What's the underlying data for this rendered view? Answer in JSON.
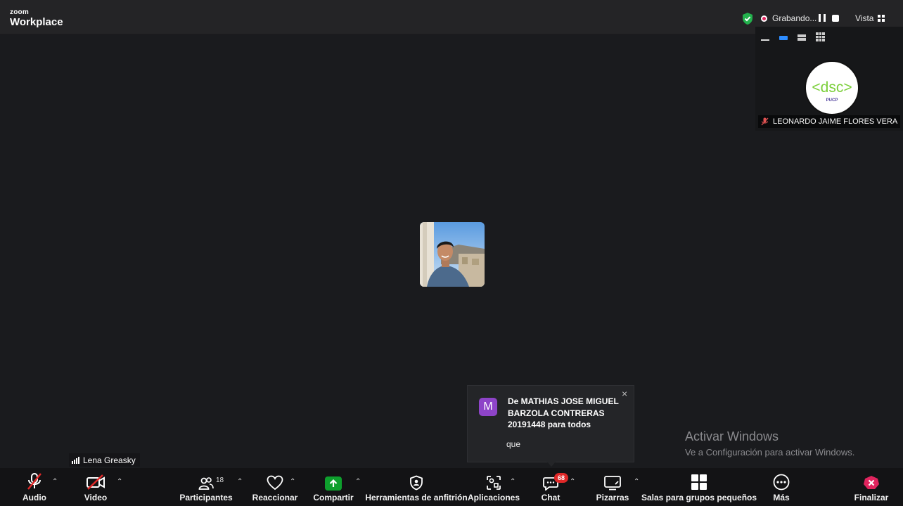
{
  "app": {
    "brand_line1": "zoom",
    "brand_line2": "Workplace"
  },
  "topbar": {
    "recording_label": "Grabando...",
    "view_label": "Vista"
  },
  "speaker_panel": {
    "participant_name": "LEONARDO JAIME FLORES VERA",
    "avatar_text": "<dsc>",
    "avatar_subtext": "PUCP"
  },
  "self_view": {
    "name": "Lena Greasky"
  },
  "chat_toast": {
    "avatar_letter": "M",
    "sender_line": "De MATHIAS JOSE MIGUEL BARZOLA CONTRERAS 20191448 para todos",
    "message": "que",
    "close_glyph": "×"
  },
  "watermark": {
    "title": "Activar Windows",
    "subtitle": "Ve a Configuración para activar Windows."
  },
  "toolbar": {
    "audio": "Audio",
    "video": "Video",
    "participants": "Participantes",
    "participants_count": "18",
    "react": "Reaccionar",
    "share": "Compartir",
    "host_tools": "Herramientas de anfitrión",
    "apps": "Aplicaciones",
    "chat": "Chat",
    "chat_badge": "68",
    "whiteboards": "Pizarras",
    "breakout": "Salas para grupos pequeños",
    "more": "Más",
    "end": "Finalizar"
  },
  "colors": {
    "share_green": "#0e9f2d",
    "end_red": "#e0245e",
    "toast_avatar": "#8e44c8",
    "badge_red": "#e02828",
    "accent_blue": "#2d8cff"
  }
}
